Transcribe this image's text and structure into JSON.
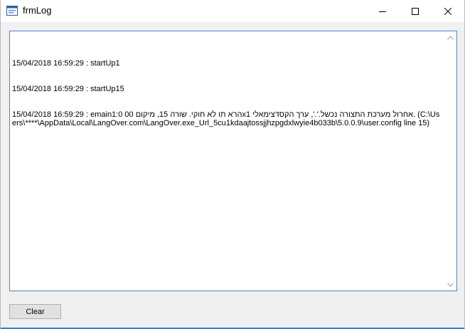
{
  "window": {
    "title": "frmLog",
    "icons": {
      "app": "form-window-icon",
      "minimize": "minimize-icon",
      "maximize": "maximize-icon",
      "close": "close-icon"
    },
    "accent_color": "#4b84c9"
  },
  "log": {
    "lines": [
      "15/04/2018 16:59:29 : startUp1",
      "15/04/2018 16:59:29 : startUp15",
      "15/04/2018 16:59:29 : emain1:0 הרא תו לא חוקי. שורה 15, מיקום 00xאחרול מערכת התצורה נכשל.'.', ערך הקסדצימאלי 1. (C:\\Users\\****\\AppData\\Local\\LangOver.com\\LangOver.exe_Url_5cu1kdaajtossjjhzpgdxlwyie4b033b\\5.0.0.9\\user.config line 15)"
    ]
  },
  "actions": {
    "clear_label": "Clear"
  }
}
